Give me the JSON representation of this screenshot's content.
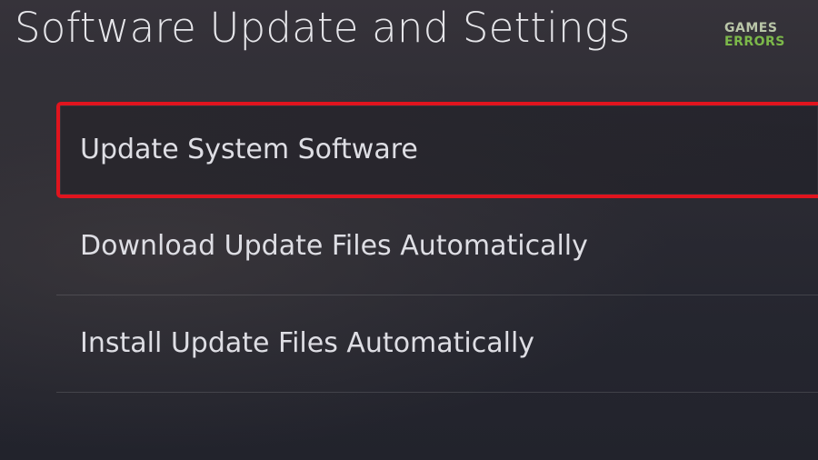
{
  "page": {
    "title": "Software Update and Settings"
  },
  "watermark": {
    "line1": "GAMES",
    "line2": "ERRORS"
  },
  "menu": {
    "items": [
      {
        "label": "Update System Software",
        "selected": true
      },
      {
        "label": "Download Update Files Automatically",
        "selected": false
      },
      {
        "label": "Install Update Files Automatically",
        "selected": false
      }
    ]
  },
  "colors": {
    "highlight_border": "#e0141e",
    "watermark_green": "#7cb84a"
  }
}
